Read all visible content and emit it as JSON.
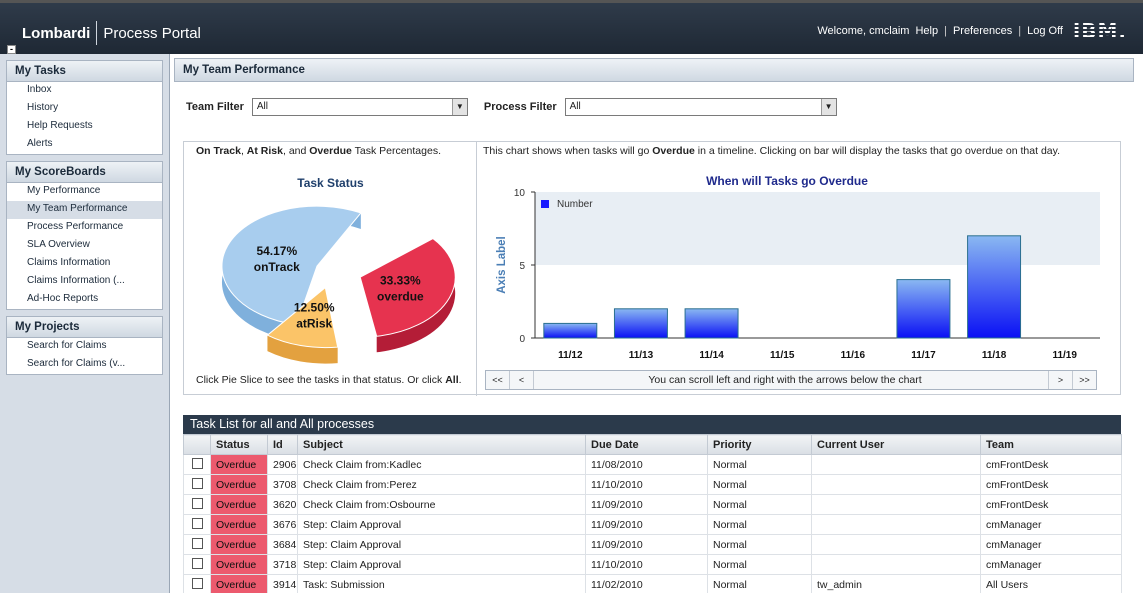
{
  "header": {
    "brand_primary": "Lombardi",
    "brand_secondary": "Process Portal",
    "welcome": "Welcome, cmclaim",
    "help": "Help",
    "preferences": "Preferences",
    "logoff": "Log Off",
    "vendor_logo": "IBM."
  },
  "nav": {
    "groups": [
      {
        "title": "My Tasks",
        "items": [
          "Inbox",
          "History",
          "Help Requests",
          "Alerts"
        ]
      },
      {
        "title": "My ScoreBoards",
        "items": [
          "My Performance",
          "My Team Performance",
          "Process Performance",
          "SLA Overview",
          "Claims Information",
          "Claims Information (...",
          "Ad-Hoc Reports"
        ],
        "selected": 1
      },
      {
        "title": "My Projects",
        "items": [
          "Search for Claims",
          "Search for Claims (v..."
        ]
      }
    ]
  },
  "page": {
    "title": "My Team Performance",
    "team_filter_label": "Team Filter",
    "team_filter_value": "All",
    "process_filter_label": "Process Filter",
    "process_filter_value": "All"
  },
  "pie": {
    "caption_b1": "On Track",
    "caption_s1": ", ",
    "caption_b2": "At Risk",
    "caption_s2": ", and ",
    "caption_b3": "Overdue",
    "caption_s3": " Task Percentages.",
    "title": "Task Status",
    "foot_text": "Click Pie Slice to see the tasks in that status. Or click ",
    "foot_bold": "All",
    "foot_end": "."
  },
  "bar": {
    "caption_a": "This chart shows when tasks will go ",
    "caption_b": "Overdue",
    "caption_c": " in a timeline. Clicking on bar will display the tasks that go overdue on that day.",
    "scroll_first": "<<",
    "scroll_prev": "<",
    "scroll_msg": "You can scroll left and right with the arrows below the chart",
    "scroll_next": ">",
    "scroll_last": ">>"
  },
  "chart_data": [
    {
      "type": "pie",
      "title": "Task Status",
      "slices": [
        {
          "label": "onTrack",
          "value": 54.17,
          "display": "54.17%",
          "color": "#a8cdee"
        },
        {
          "label": "overdue",
          "value": 33.33,
          "display": "33.33%",
          "color": "#e6334f"
        },
        {
          "label": "atRisk",
          "value": 12.5,
          "display": "12.50%",
          "color": "#fbc468"
        }
      ]
    },
    {
      "type": "bar",
      "title": "When will Tasks go Overdue",
      "ylabel": "Axis Label",
      "ylim": [
        0,
        10
      ],
      "yticks": [
        0,
        5,
        10
      ],
      "categories": [
        "11/12",
        "11/13",
        "11/14",
        "11/15",
        "11/16",
        "11/17",
        "11/18",
        "11/19"
      ],
      "series": [
        {
          "name": "Number",
          "values": [
            1,
            2,
            2,
            0,
            0,
            4,
            7,
            0
          ],
          "color": "#1a1aff"
        }
      ],
      "legend": "top-left"
    }
  ],
  "tasks": {
    "title": "Task List for all and All processes",
    "columns": [
      "",
      "Status",
      "Id",
      "Subject",
      "Due Date",
      "Priority",
      "Current User",
      "Team"
    ],
    "rows": [
      [
        "Overdue",
        "2906",
        "Check Claim from:Kadlec",
        "11/08/2010",
        "Normal",
        "",
        "cmFrontDesk"
      ],
      [
        "Overdue",
        "3708",
        "Check Claim from:Perez",
        "11/10/2010",
        "Normal",
        "",
        "cmFrontDesk"
      ],
      [
        "Overdue",
        "3620",
        "Check Claim from:Osbourne",
        "11/09/2010",
        "Normal",
        "",
        "cmFrontDesk"
      ],
      [
        "Overdue",
        "3676",
        "Step: Claim Approval",
        "11/09/2010",
        "Normal",
        "",
        "cmManager"
      ],
      [
        "Overdue",
        "3684",
        "Step: Claim Approval",
        "11/09/2010",
        "Normal",
        "",
        "cmManager"
      ],
      [
        "Overdue",
        "3718",
        "Step: Claim Approval",
        "11/10/2010",
        "Normal",
        "",
        "cmManager"
      ],
      [
        "Overdue",
        "3914",
        "Task: Submission",
        "11/02/2010",
        "Normal",
        "tw_admin",
        "All Users"
      ]
    ]
  }
}
